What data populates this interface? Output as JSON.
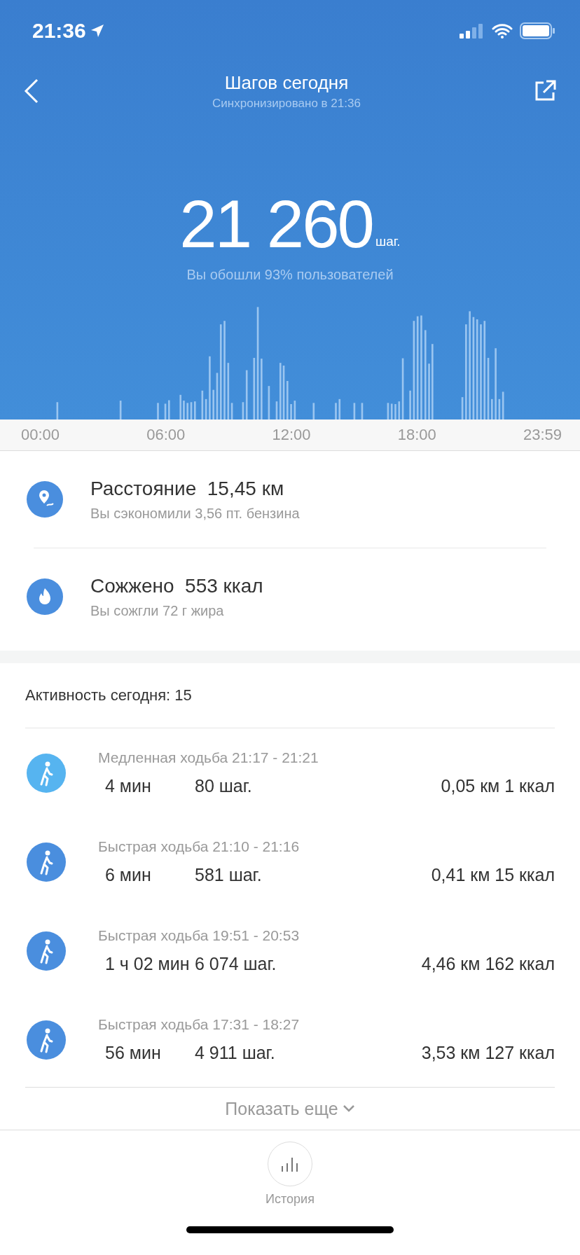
{
  "status_bar": {
    "time": "21:36"
  },
  "header": {
    "title": "Шагов сегодня",
    "subtitle": "Синхронизировано в 21:36"
  },
  "steps": {
    "value": "21 260",
    "unit": "шаг.",
    "comparison": "Вы обошли 93% пользователей"
  },
  "chart": {
    "time_labels": [
      "00:00",
      "06:00",
      "12:00",
      "18:00",
      "23:59"
    ]
  },
  "summary": [
    {
      "kind": "distance",
      "label": "Расстояние",
      "value": "15,45 км",
      "note": "Вы сэкономили 3,56 пт. бензина"
    },
    {
      "kind": "calories",
      "label": "Сожжено",
      "value": "553 ккал",
      "note": "Вы сожгли 72 г жира"
    }
  ],
  "activity": {
    "title": "Активность сегодня: 15",
    "items": [
      {
        "title": "Медленная ходьба 21:17 - 21:21",
        "duration": "4 мин",
        "steps": "80 шаг.",
        "totals": "0,05 км 1 ккал",
        "color": "#56b4f0"
      },
      {
        "title": "Быстрая ходьба 21:10 - 21:16",
        "duration": "6 мин",
        "steps": "581 шаг.",
        "totals": "0,41 км 15 ккал",
        "color": "#4a8ede"
      },
      {
        "title": "Быстрая ходьба 19:51 - 20:53",
        "duration": "1 ч 02 мин",
        "steps": "6 074 шаг.",
        "totals": "4,46 км 162 ккал",
        "color": "#4a8ede"
      },
      {
        "title": "Быстрая ходьба 17:31 - 18:27",
        "duration": "56 мин",
        "steps": "4 911 шаг.",
        "totals": "3,53 км 127 ккал",
        "color": "#4a8ede"
      }
    ],
    "show_more": "Показать еще"
  },
  "bottom_bar": {
    "history": "История"
  }
}
